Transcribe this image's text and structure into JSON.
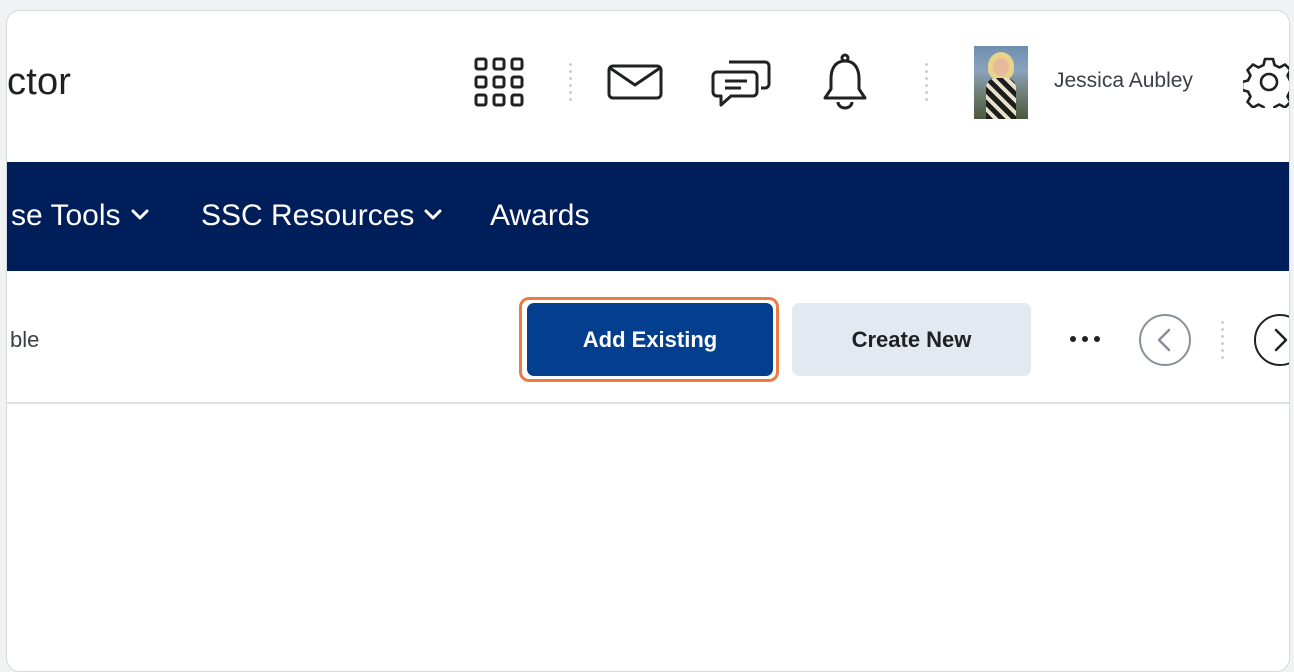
{
  "header": {
    "brand_text": "ctor",
    "icons": [
      "app-grid-icon",
      "email-icon",
      "chat-icon",
      "bell-icon",
      "gear-icon"
    ],
    "user": {
      "name": "Jessica Aubley"
    }
  },
  "navbar": {
    "background": "#001e5a",
    "items": [
      {
        "label": "se Tools",
        "has_dropdown": true
      },
      {
        "label": "SSC Resources",
        "has_dropdown": true
      },
      {
        "label": "Awards",
        "has_dropdown": false
      }
    ]
  },
  "toolbar": {
    "partial_label": "ble",
    "add_existing_label": "Add Existing",
    "create_new_label": "Create New",
    "more_label": "•••",
    "highlight_color": "#ec7a45",
    "primary_color": "#033e8f"
  }
}
